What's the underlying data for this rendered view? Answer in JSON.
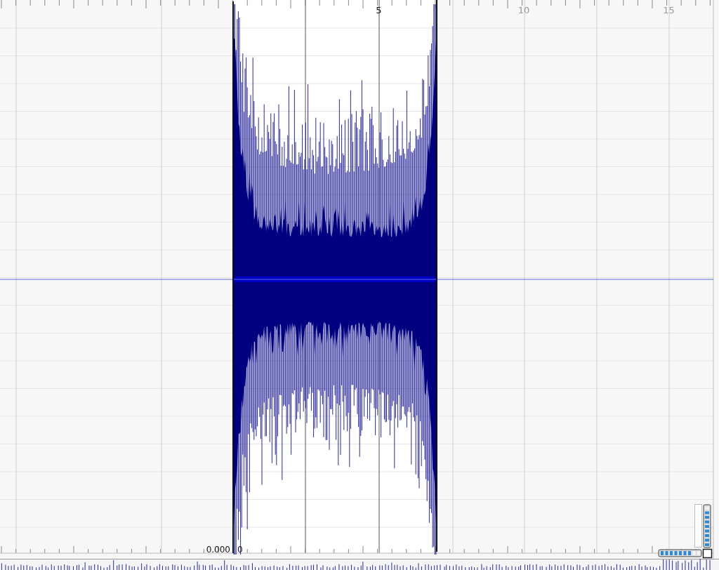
{
  "ruler": {
    "labels": [
      "5",
      "10",
      "15"
    ]
  },
  "amplitude_label": "0.000",
  "position_label": "0",
  "vertical_zoom": {
    "level": 0.9
  },
  "horizontal_zoom": {
    "level": 0.8
  }
}
